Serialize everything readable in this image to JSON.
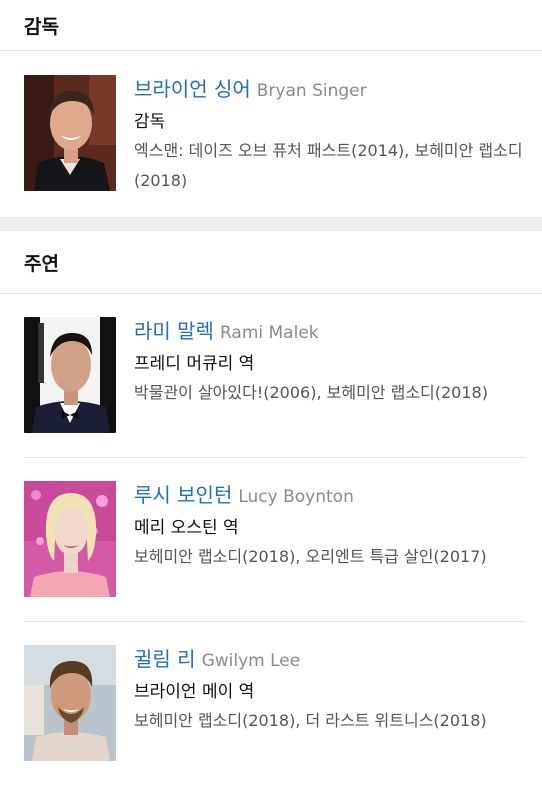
{
  "director_section": {
    "title": "감독",
    "people": [
      {
        "name_ko": "브라이언 싱어",
        "name_en": "Bryan Singer",
        "role": "감독",
        "works": "엑스맨: 데이즈 오브 퓨처 패스트(2014), 보헤미안 랩소디(2018)"
      }
    ]
  },
  "cast_section": {
    "title": "주연",
    "people": [
      {
        "name_ko": "라미 말렉",
        "name_en": "Rami Malek",
        "role": "프레디 머큐리 역",
        "works": "박물관이 살아있다!(2006), 보헤미안 랩소디(2018)"
      },
      {
        "name_ko": "루시 보인턴",
        "name_en": "Lucy Boynton",
        "role": "메리 오스틴 역",
        "works": "보헤미안 랩소디(2018), 오리엔트 특급 살인(2017)"
      },
      {
        "name_ko": "귈림 리",
        "name_en": "Gwilym Lee",
        "role": "브라이언 메이 역",
        "works": "보헤미안 랩소디(2018), 더 라스트 위트니스(2018)"
      }
    ]
  }
}
